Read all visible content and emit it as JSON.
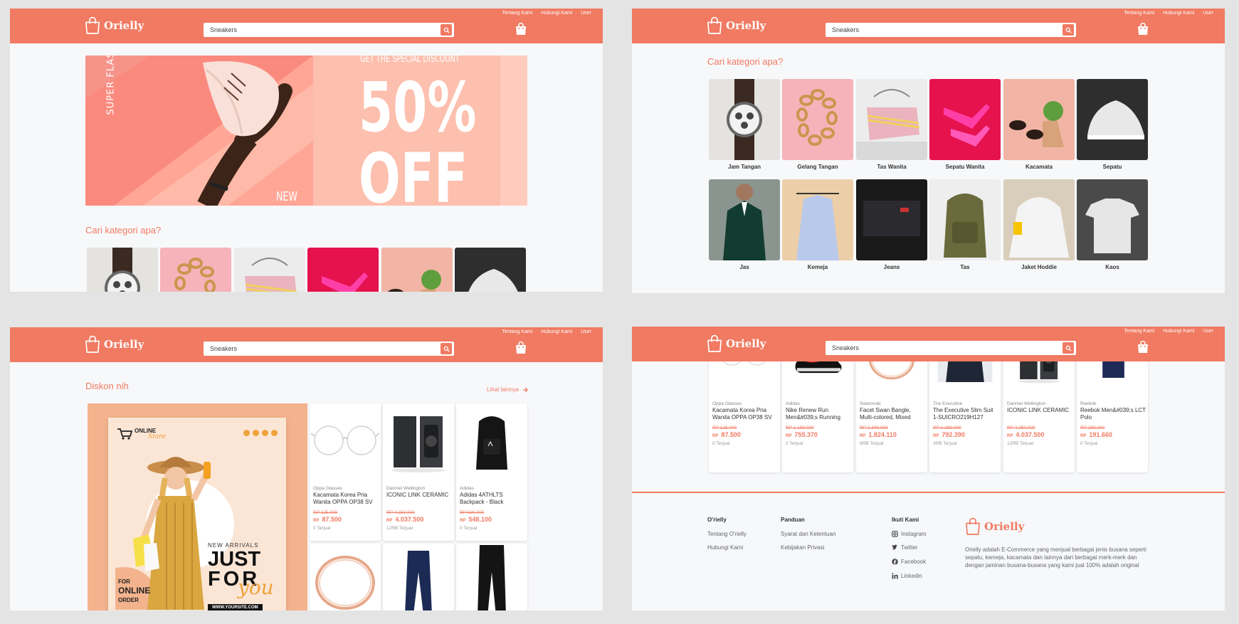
{
  "header": {
    "logo_text": "Orielly",
    "links": [
      "Tentang Kami",
      "Hubungi Kami",
      "User"
    ],
    "search_value": "Sneakers"
  },
  "hero": {
    "vertical_text": "SUPER FLASH",
    "tagline": "GET THE SPECIAL DISCOUNT",
    "percent": "50%",
    "off": "OFF",
    "new_label": "NEW"
  },
  "categories": {
    "title": "Cari kategori apa?",
    "items": [
      "Jam Tangan",
      "Gelang Tangan",
      "Tas Wanita",
      "Sepatu Wanita",
      "Kacamata",
      "Sepatu",
      "Jas",
      "Kemeja",
      "Jeans",
      "Tas",
      "Jaket Hoddie",
      "Kaos"
    ]
  },
  "discount": {
    "title": "Diskon nih",
    "see_all": "Lihat lainnya",
    "promo": {
      "brand_line1": "ONLINE",
      "brand_line2": "Store",
      "new_arrivals": "NEW ARRIVALS",
      "just": "JUST",
      "for": "FOR",
      "you": "you",
      "for_online": "FOR",
      "online": "ONLINE",
      "order": "ORDER",
      "url": "WWW.YOURSITE.COM"
    },
    "products": [
      {
        "brand": "Oppa Glasses",
        "name": "Kacamata Korea Pria Wanita OPPA OP38 SV",
        "old": "RP 125.000",
        "cur": "RP",
        "price": "87.500",
        "sold": "0 Terjual"
      },
      {
        "brand": "Danniel Wellington",
        "name": "ICONIC LINK CERAMIC",
        "old": "RP 4.250.000",
        "cur": "RP",
        "price": "4.037.500",
        "sold": "12RB Terjual"
      },
      {
        "brand": "Adidas",
        "name": "Adidas 4ATHLTS Backpack - Black",
        "old": "RP 630.000",
        "cur": "RP",
        "price": "548.100",
        "sold": "0 Terjual"
      }
    ]
  },
  "products_row": [
    {
      "brand": "Oppa Glasses",
      "name": "Kacamata Korea Pria Wanita OPPA OP38 SV",
      "old": "RP 125.000",
      "cur": "RP",
      "price": "87.500",
      "sold": "0 Terjual"
    },
    {
      "brand": "Adidas",
      "name": "Nike Renew Run Men&#039;s Running",
      "old": "RP 1.199.000",
      "cur": "RP",
      "price": "755.370",
      "sold": "0 Terjual"
    },
    {
      "brand": "Swarovski",
      "name": "Facet Swan Bangle, Multi-colored, Mixed",
      "old": "RP 2.309.000",
      "cur": "RP",
      "price": "1.824.110",
      "sold": "6RB Terjual"
    },
    {
      "brand": "The Executive",
      "name": "The Executive Slim Suit 1-SUICRO219H127 DARK",
      "old": "RP 1.299.000",
      "cur": "RP",
      "price": "792.390",
      "sold": "3RB Terjual"
    },
    {
      "brand": "Danniel Wellington",
      "name": "ICONIC LINK CERAMIC",
      "old": "RP 4.250.000",
      "cur": "RP",
      "price": "4.037.500",
      "sold": "12RB Terjual"
    },
    {
      "brand": "Reebok",
      "name": "Reebok Men&#039;s LCT Polo",
      "old": "RP 259.000",
      "cur": "RP",
      "price": "191.660",
      "sold": "0 Terjual"
    }
  ],
  "footer": {
    "col1_title": "O'rielly",
    "col1_links": [
      "Tentang O'rielly",
      "Hubungi Kami"
    ],
    "col2_title": "Panduan",
    "col2_links": [
      "Syarat dan Ketentuan",
      "Kebijakan Privasi"
    ],
    "col3_title": "Ikuti Kami",
    "social": [
      "Instagram",
      "Twitter",
      "Facebook",
      "Linkedin"
    ],
    "logo_text": "Orielly",
    "description": "Orielly adalah E-Commerce yang menjual berbagai jenis busana seperti sepatu, kemeja, kacamata dan lainnya dari berbagai merk-merk dan dengan jaminan busana-busana yang kami jual 100% adalah original"
  },
  "colors": {
    "accent": "#f07a62",
    "background": "#f7f8fa",
    "frame": "#e4e4e4"
  }
}
